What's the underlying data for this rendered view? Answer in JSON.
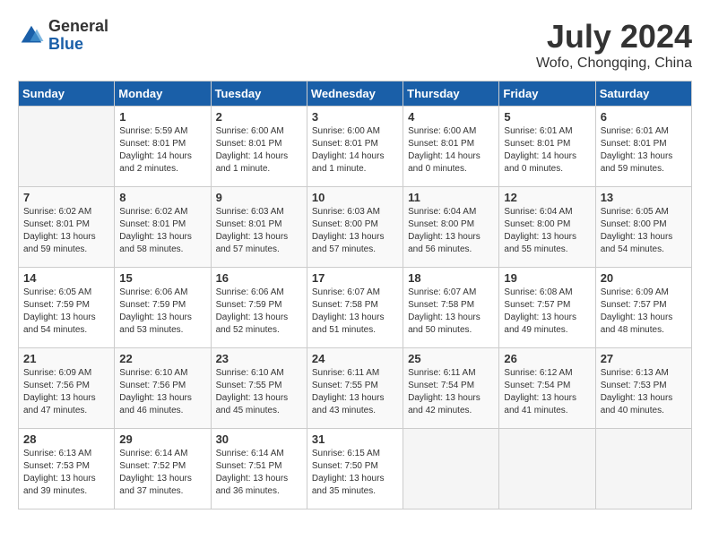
{
  "header": {
    "logo_general": "General",
    "logo_blue": "Blue",
    "month_title": "July 2024",
    "location": "Wofo, Chongqing, China"
  },
  "calendar": {
    "days_of_week": [
      "Sunday",
      "Monday",
      "Tuesday",
      "Wednesday",
      "Thursday",
      "Friday",
      "Saturday"
    ],
    "weeks": [
      [
        {
          "day": "",
          "info": ""
        },
        {
          "day": "1",
          "info": "Sunrise: 5:59 AM\nSunset: 8:01 PM\nDaylight: 14 hours\nand 2 minutes."
        },
        {
          "day": "2",
          "info": "Sunrise: 6:00 AM\nSunset: 8:01 PM\nDaylight: 14 hours\nand 1 minute."
        },
        {
          "day": "3",
          "info": "Sunrise: 6:00 AM\nSunset: 8:01 PM\nDaylight: 14 hours\nand 1 minute."
        },
        {
          "day": "4",
          "info": "Sunrise: 6:00 AM\nSunset: 8:01 PM\nDaylight: 14 hours\nand 0 minutes."
        },
        {
          "day": "5",
          "info": "Sunrise: 6:01 AM\nSunset: 8:01 PM\nDaylight: 14 hours\nand 0 minutes."
        },
        {
          "day": "6",
          "info": "Sunrise: 6:01 AM\nSunset: 8:01 PM\nDaylight: 13 hours\nand 59 minutes."
        }
      ],
      [
        {
          "day": "7",
          "info": "Sunrise: 6:02 AM\nSunset: 8:01 PM\nDaylight: 13 hours\nand 59 minutes."
        },
        {
          "day": "8",
          "info": "Sunrise: 6:02 AM\nSunset: 8:01 PM\nDaylight: 13 hours\nand 58 minutes."
        },
        {
          "day": "9",
          "info": "Sunrise: 6:03 AM\nSunset: 8:01 PM\nDaylight: 13 hours\nand 57 minutes."
        },
        {
          "day": "10",
          "info": "Sunrise: 6:03 AM\nSunset: 8:00 PM\nDaylight: 13 hours\nand 57 minutes."
        },
        {
          "day": "11",
          "info": "Sunrise: 6:04 AM\nSunset: 8:00 PM\nDaylight: 13 hours\nand 56 minutes."
        },
        {
          "day": "12",
          "info": "Sunrise: 6:04 AM\nSunset: 8:00 PM\nDaylight: 13 hours\nand 55 minutes."
        },
        {
          "day": "13",
          "info": "Sunrise: 6:05 AM\nSunset: 8:00 PM\nDaylight: 13 hours\nand 54 minutes."
        }
      ],
      [
        {
          "day": "14",
          "info": "Sunrise: 6:05 AM\nSunset: 7:59 PM\nDaylight: 13 hours\nand 54 minutes."
        },
        {
          "day": "15",
          "info": "Sunrise: 6:06 AM\nSunset: 7:59 PM\nDaylight: 13 hours\nand 53 minutes."
        },
        {
          "day": "16",
          "info": "Sunrise: 6:06 AM\nSunset: 7:59 PM\nDaylight: 13 hours\nand 52 minutes."
        },
        {
          "day": "17",
          "info": "Sunrise: 6:07 AM\nSunset: 7:58 PM\nDaylight: 13 hours\nand 51 minutes."
        },
        {
          "day": "18",
          "info": "Sunrise: 6:07 AM\nSunset: 7:58 PM\nDaylight: 13 hours\nand 50 minutes."
        },
        {
          "day": "19",
          "info": "Sunrise: 6:08 AM\nSunset: 7:57 PM\nDaylight: 13 hours\nand 49 minutes."
        },
        {
          "day": "20",
          "info": "Sunrise: 6:09 AM\nSunset: 7:57 PM\nDaylight: 13 hours\nand 48 minutes."
        }
      ],
      [
        {
          "day": "21",
          "info": "Sunrise: 6:09 AM\nSunset: 7:56 PM\nDaylight: 13 hours\nand 47 minutes."
        },
        {
          "day": "22",
          "info": "Sunrise: 6:10 AM\nSunset: 7:56 PM\nDaylight: 13 hours\nand 46 minutes."
        },
        {
          "day": "23",
          "info": "Sunrise: 6:10 AM\nSunset: 7:55 PM\nDaylight: 13 hours\nand 45 minutes."
        },
        {
          "day": "24",
          "info": "Sunrise: 6:11 AM\nSunset: 7:55 PM\nDaylight: 13 hours\nand 43 minutes."
        },
        {
          "day": "25",
          "info": "Sunrise: 6:11 AM\nSunset: 7:54 PM\nDaylight: 13 hours\nand 42 minutes."
        },
        {
          "day": "26",
          "info": "Sunrise: 6:12 AM\nSunset: 7:54 PM\nDaylight: 13 hours\nand 41 minutes."
        },
        {
          "day": "27",
          "info": "Sunrise: 6:13 AM\nSunset: 7:53 PM\nDaylight: 13 hours\nand 40 minutes."
        }
      ],
      [
        {
          "day": "28",
          "info": "Sunrise: 6:13 AM\nSunset: 7:53 PM\nDaylight: 13 hours\nand 39 minutes."
        },
        {
          "day": "29",
          "info": "Sunrise: 6:14 AM\nSunset: 7:52 PM\nDaylight: 13 hours\nand 37 minutes."
        },
        {
          "day": "30",
          "info": "Sunrise: 6:14 AM\nSunset: 7:51 PM\nDaylight: 13 hours\nand 36 minutes."
        },
        {
          "day": "31",
          "info": "Sunrise: 6:15 AM\nSunset: 7:50 PM\nDaylight: 13 hours\nand 35 minutes."
        },
        {
          "day": "",
          "info": ""
        },
        {
          "day": "",
          "info": ""
        },
        {
          "day": "",
          "info": ""
        }
      ]
    ]
  }
}
